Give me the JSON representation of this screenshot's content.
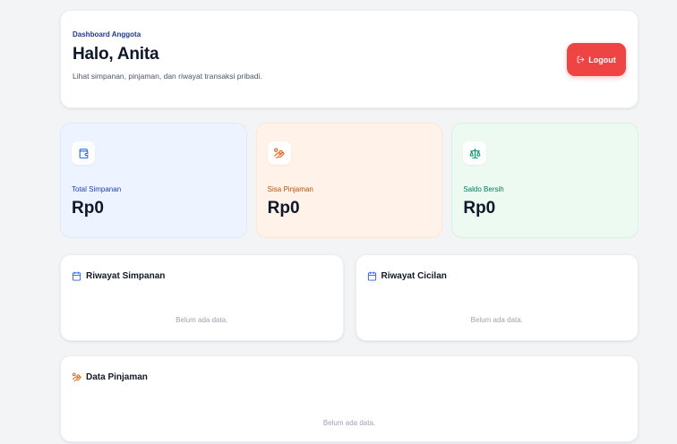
{
  "header": {
    "eyebrow": "Dashboard Anggota",
    "greeting": "Halo, Anita",
    "subtitle": "Lihat simpanan, pinjaman, dan riwayat transaksi pribadi.",
    "logout_label": "Logout"
  },
  "stats": [
    {
      "label": "Total Simpanan",
      "value": "Rp0",
      "icon": "wallet-icon",
      "color": "#2563eb"
    },
    {
      "label": "Sisa Pinjaman",
      "value": "Rp0",
      "icon": "hand-coins-icon",
      "color": "#ea580c"
    },
    {
      "label": "Saldo Bersih",
      "value": "Rp0",
      "icon": "scale-icon",
      "color": "#059669"
    }
  ],
  "panels": {
    "simpanan": {
      "title": "Riwayat Simpanan",
      "empty": "Belum ada data."
    },
    "cicilan": {
      "title": "Riwayat Cicilan",
      "empty": "Belum ada data."
    },
    "pinjaman": {
      "title": "Data Pinjaman",
      "empty": "Belum ada data."
    }
  },
  "colors": {
    "logout": "#ef4444",
    "accent_blue": "#2563eb",
    "accent_orange": "#ea580c",
    "accent_green": "#059669"
  }
}
